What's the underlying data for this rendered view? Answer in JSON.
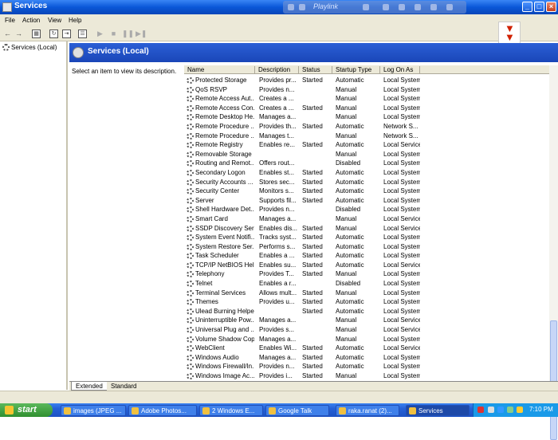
{
  "window": {
    "title": "Services",
    "overlay_label": "Playlink"
  },
  "menu": [
    "File",
    "Action",
    "View",
    "Help"
  ],
  "tree": {
    "root_label": "Services (Local)"
  },
  "panel": {
    "title": "Services (Local)",
    "description_prompt": "Select an item to view its description."
  },
  "columns": [
    "Name",
    "Description",
    "Status",
    "Startup Type",
    "Log On As"
  ],
  "services": [
    {
      "name": "Protected Storage",
      "desc": "Provides pr...",
      "status": "Started",
      "startup": "Automatic",
      "logon": "Local System"
    },
    {
      "name": "QoS RSVP",
      "desc": "Provides n...",
      "status": "",
      "startup": "Manual",
      "logon": "Local System"
    },
    {
      "name": "Remote Access Aut...",
      "desc": "Creates a ...",
      "status": "",
      "startup": "Manual",
      "logon": "Local System"
    },
    {
      "name": "Remote Access Con...",
      "desc": "Creates a ...",
      "status": "Started",
      "startup": "Manual",
      "logon": "Local System"
    },
    {
      "name": "Remote Desktop He...",
      "desc": "Manages a...",
      "status": "",
      "startup": "Manual",
      "logon": "Local System"
    },
    {
      "name": "Remote Procedure ...",
      "desc": "Provides th...",
      "status": "Started",
      "startup": "Automatic",
      "logon": "Network S..."
    },
    {
      "name": "Remote Procedure ...",
      "desc": "Manages t...",
      "status": "",
      "startup": "Manual",
      "logon": "Network S..."
    },
    {
      "name": "Remote Registry",
      "desc": "Enables re...",
      "status": "Started",
      "startup": "Automatic",
      "logon": "Local Service"
    },
    {
      "name": "Removable Storage",
      "desc": "",
      "status": "",
      "startup": "Manual",
      "logon": "Local System"
    },
    {
      "name": "Routing and Remot...",
      "desc": "Offers rout...",
      "status": "",
      "startup": "Disabled",
      "logon": "Local System"
    },
    {
      "name": "Secondary Logon",
      "desc": "Enables st...",
      "status": "Started",
      "startup": "Automatic",
      "logon": "Local System"
    },
    {
      "name": "Security Accounts ...",
      "desc": "Stores sec...",
      "status": "Started",
      "startup": "Automatic",
      "logon": "Local System"
    },
    {
      "name": "Security Center",
      "desc": "Monitors s...",
      "status": "Started",
      "startup": "Automatic",
      "logon": "Local System"
    },
    {
      "name": "Server",
      "desc": "Supports fil...",
      "status": "Started",
      "startup": "Automatic",
      "logon": "Local System"
    },
    {
      "name": "Shell Hardware Det...",
      "desc": "Provides n...",
      "status": "",
      "startup": "Disabled",
      "logon": "Local System"
    },
    {
      "name": "Smart Card",
      "desc": "Manages a...",
      "status": "",
      "startup": "Manual",
      "logon": "Local Service"
    },
    {
      "name": "SSDP Discovery Ser...",
      "desc": "Enables dis...",
      "status": "Started",
      "startup": "Manual",
      "logon": "Local Service"
    },
    {
      "name": "System Event Notifi...",
      "desc": "Tracks syst...",
      "status": "Started",
      "startup": "Automatic",
      "logon": "Local System"
    },
    {
      "name": "System Restore Ser...",
      "desc": "Performs s...",
      "status": "Started",
      "startup": "Automatic",
      "logon": "Local System"
    },
    {
      "name": "Task Scheduler",
      "desc": "Enables a ...",
      "status": "Started",
      "startup": "Automatic",
      "logon": "Local System"
    },
    {
      "name": "TCP/IP NetBIOS Hel...",
      "desc": "Enables su...",
      "status": "Started",
      "startup": "Automatic",
      "logon": "Local Service"
    },
    {
      "name": "Telephony",
      "desc": "Provides T...",
      "status": "Started",
      "startup": "Manual",
      "logon": "Local System"
    },
    {
      "name": "Telnet",
      "desc": "Enables a r...",
      "status": "",
      "startup": "Disabled",
      "logon": "Local System"
    },
    {
      "name": "Terminal Services",
      "desc": "Allows mult...",
      "status": "Started",
      "startup": "Manual",
      "logon": "Local System"
    },
    {
      "name": "Themes",
      "desc": "Provides u...",
      "status": "Started",
      "startup": "Automatic",
      "logon": "Local System"
    },
    {
      "name": "Ulead Burning Helper",
      "desc": "",
      "status": "Started",
      "startup": "Automatic",
      "logon": "Local System"
    },
    {
      "name": "Uninterruptible Pow...",
      "desc": "Manages a...",
      "status": "",
      "startup": "Manual",
      "logon": "Local Service"
    },
    {
      "name": "Universal Plug and ...",
      "desc": "Provides s...",
      "status": "",
      "startup": "Manual",
      "logon": "Local Service"
    },
    {
      "name": "Volume Shadow Copy",
      "desc": "Manages a...",
      "status": "",
      "startup": "Manual",
      "logon": "Local System"
    },
    {
      "name": "WebClient",
      "desc": "Enables Wi...",
      "status": "Started",
      "startup": "Automatic",
      "logon": "Local Service"
    },
    {
      "name": "Windows Audio",
      "desc": "Manages a...",
      "status": "Started",
      "startup": "Automatic",
      "logon": "Local System"
    },
    {
      "name": "Windows Firewall/In...",
      "desc": "Provides n...",
      "status": "Started",
      "startup": "Automatic",
      "logon": "Local System"
    },
    {
      "name": "Windows Image Ac...",
      "desc": "Provides i...",
      "status": "Started",
      "startup": "Manual",
      "logon": "Local System"
    }
  ],
  "tabs": [
    "Extended",
    "Standard"
  ],
  "taskbar": {
    "start_label": "start",
    "tasks": [
      "images (JPEG ...",
      "Adobe Photos...",
      "2 Windows E...",
      "Google Talk",
      "raka.ranat (2)...",
      "Services"
    ],
    "clock": "7:10 PM"
  },
  "colors": {
    "titlebar": "#0a57d8",
    "panel_header": "#1a46b8",
    "chrome": "#ece9d8",
    "start_button": "#2f8f2f",
    "download_arrow": "#d02000"
  }
}
